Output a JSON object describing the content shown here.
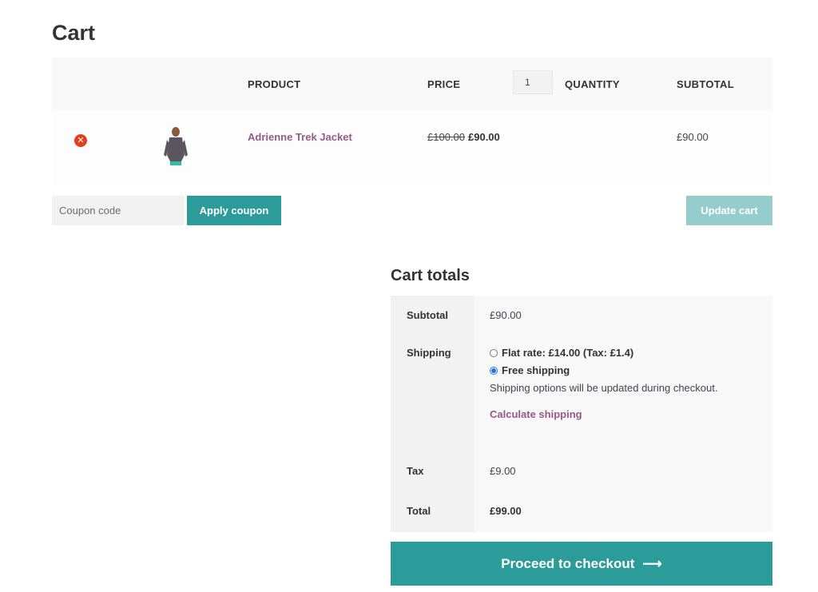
{
  "page": {
    "title": "Cart"
  },
  "cart_table": {
    "columns": {
      "product": "PRODUCT",
      "price": "PRICE",
      "quantity": "QUANTITY",
      "subtotal": "SUBTOTAL"
    },
    "items": [
      {
        "name": "Adrienne Trek Jacket",
        "regular_price": "£100.00",
        "sale_price": "£90.00",
        "quantity": "1",
        "subtotal": "£90.00"
      }
    ]
  },
  "coupon": {
    "placeholder": "Coupon code",
    "apply_label": "Apply coupon"
  },
  "update_cart_label": "Update cart",
  "totals": {
    "title": "Cart totals",
    "subtotal_label": "Subtotal",
    "subtotal_value": "£90.00",
    "shipping_label": "Shipping",
    "shipping_options": [
      {
        "label": "Flat rate: £14.00 (Tax: £1.4)",
        "selected": false
      },
      {
        "label": "Free shipping",
        "selected": true
      }
    ],
    "shipping_note": "Shipping options will be updated during checkout.",
    "calculate_shipping": "Calculate shipping",
    "tax_label": "Tax",
    "tax_value": "£9.00",
    "total_label": "Total",
    "total_value": "£99.00"
  },
  "checkout": {
    "label": "Proceed to checkout",
    "arrow": "⟶"
  },
  "colors": {
    "accent": "#2c9c9a",
    "link": "#96588a",
    "remove": "#e2401c"
  }
}
